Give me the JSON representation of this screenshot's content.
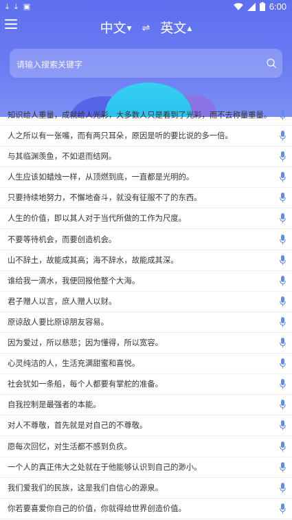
{
  "status_bar": {
    "time": "6:00"
  },
  "toolbar": {
    "source_lang": "中文",
    "target_lang": "英文",
    "swap_symbol": "⇌"
  },
  "search": {
    "placeholder": "请输入搜索关键字"
  },
  "colors": {
    "header": "#6475f1",
    "accent_cyan": "#2fc3ef",
    "mic": "#5b8ef0"
  },
  "quotes": [
    "知识给人重量，成就给人光彩，大多数人只是看到了光彩，而不去称量重量。",
    "人之所以有一张嘴，而有两只耳朵，原因是听的要比说的多一倍。",
    "与其临渊羡鱼，不如退而结网。",
    "人生应该如蜡烛一样，从顶燃到底，一直都是光明的。",
    "只要持续地努力，不懈地奋斗，就没有征服不了的东西。",
    "人生的价值，即以其人对于当代所做的工作为尺度。",
    "不要等待机会，而要创造机会。",
    "山不辞土，故能成其高；海不辞水，故能成其深。",
    "谁给我一滴水，我便回报他整个大海。",
    "君子赠人以言，庶人赠人以财。",
    "原谅敌人要比原谅朋友容易。",
    "因为爱过，所以慈悲；因为懂得，所以宽容。",
    "心灵纯洁的人，生活充满甜蜜和喜悦。",
    "社会犹如一条船，每个人都要有掌舵的准备。",
    "自我控制是最强者的本能。",
    "对人不尊敬，首先就是对自己的不尊敬。",
    "愿每次回忆，对生活都不感到负疚。",
    "一个人的真正伟大之处就在于他能够认识到自己的渺小。",
    "我们爱我们的民族，这是我们自信心的源泉。",
    "你若要喜爱你自己的价值，你就得给世界创造价值。"
  ]
}
